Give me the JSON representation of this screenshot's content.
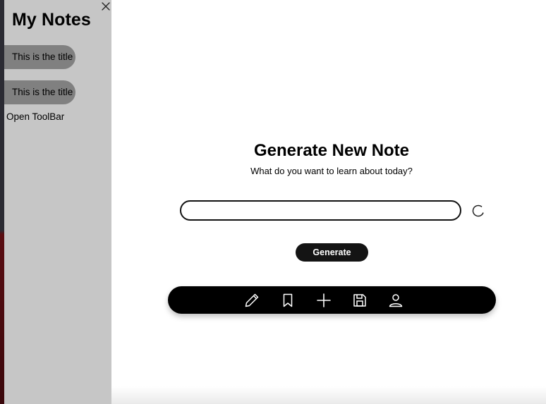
{
  "sidebar": {
    "title": "My Notes",
    "close_icon": "close-icon",
    "notes": [
      {
        "label": "This is the title"
      },
      {
        "label": "This is the title"
      }
    ],
    "open_toolbar_label": "Open ToolBar"
  },
  "main": {
    "title": "Generate New Note",
    "subtitle": "What do you want to learn about today?",
    "input": {
      "value": "",
      "placeholder": ""
    },
    "spinner_icon": "loading-spinner-icon",
    "generate_label": "Generate"
  },
  "toolbar": {
    "items": [
      {
        "icon": "pencil-icon"
      },
      {
        "icon": "bookmark-icon"
      },
      {
        "icon": "plus-icon"
      },
      {
        "icon": "save-icon"
      },
      {
        "icon": "user-icon"
      }
    ]
  },
  "colors": {
    "sidebar_bg": "#c6c6c6",
    "note_pill_bg": "#808080",
    "primary_dark": "#141414",
    "toolbar_bg": "#000000",
    "background": "#ffffff"
  }
}
